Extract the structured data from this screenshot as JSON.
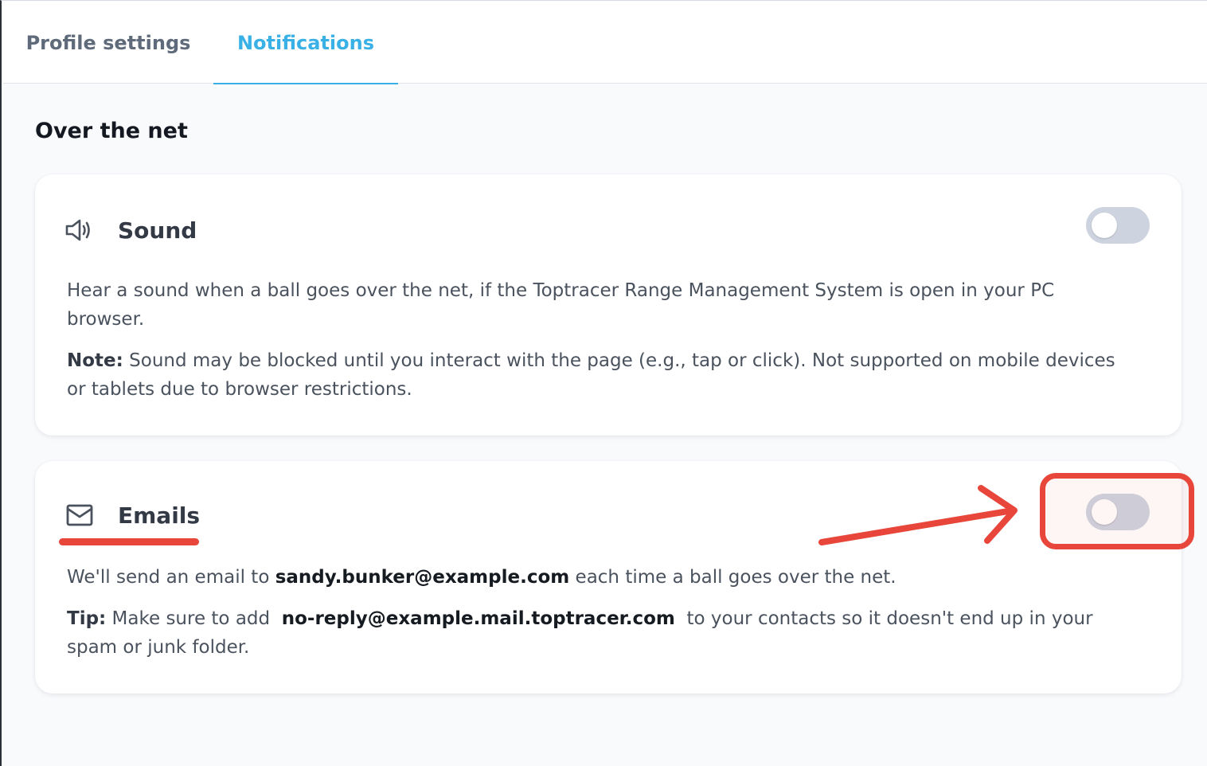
{
  "tabs": [
    {
      "label": "Profile settings",
      "active": false
    },
    {
      "label": "Notifications",
      "active": true
    }
  ],
  "section_title": "Over the net",
  "sound": {
    "icon": "speaker-icon",
    "title": "Sound",
    "enabled": false,
    "description": "Hear a sound when a ball goes over the net, if the Toptracer Range Management System is open in your PC browser.",
    "note_label": "Note:",
    "note_text": " Sound may be blocked until you interact with the page (e.g., tap or click). Not supported on mobile devices or tablets due to browser restrictions."
  },
  "emails": {
    "icon": "envelope-icon",
    "title": "Emails",
    "enabled": false,
    "desc_prefix": "We'll send an email to ",
    "user_email": "sandy.bunker@example.com",
    "desc_suffix": " each time a ball goes over the net.",
    "tip_label": "Tip:",
    "tip_prefix": " Make sure to add  ",
    "noreply_email": "no-reply@example.mail.toptracer.com",
    "tip_suffix": "  to your contacts so it doesn't end up in your spam or junk folder."
  },
  "colors": {
    "accent": "#3ab1e6",
    "annotation": "#e8463a",
    "toggle_off": "#cdd3df"
  }
}
